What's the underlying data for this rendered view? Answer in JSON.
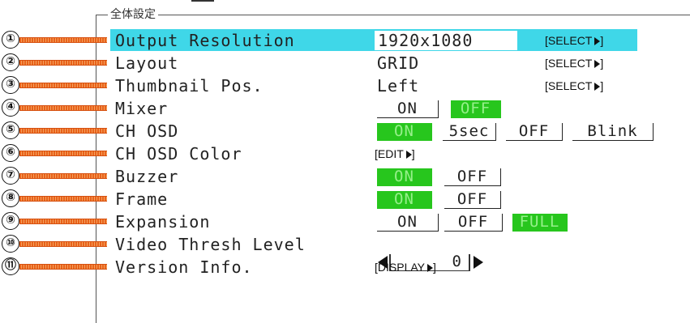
{
  "group_title": "全体設定",
  "rows": [
    {
      "num": "①",
      "label": "Output Resolution",
      "value": "1920x1080",
      "action": "[SELECT"
    },
    {
      "num": "②",
      "label": "Layout",
      "value": "GRID",
      "action": "[SELECT"
    },
    {
      "num": "③",
      "label": "Thumbnail Pos.",
      "value": "Left",
      "action": "[SELECT"
    },
    {
      "num": "④",
      "label": "Mixer",
      "options": [
        "ON",
        "OFF"
      ]
    },
    {
      "num": "⑤",
      "label": "CH OSD",
      "options": [
        "ON",
        "5sec",
        "OFF",
        "Blink"
      ]
    },
    {
      "num": "⑥",
      "label": "CH OSD Color",
      "action": "[EDIT"
    },
    {
      "num": "⑦",
      "label": "Buzzer",
      "options": [
        "ON",
        "OFF"
      ]
    },
    {
      "num": "⑧",
      "label": "Frame",
      "options": [
        "ON",
        "OFF"
      ]
    },
    {
      "num": "⑨",
      "label": "Expansion",
      "options": [
        "ON",
        "OFF",
        "FULL"
      ]
    },
    {
      "num": "⑩",
      "label": "Video Thresh Level",
      "slider_value": "0"
    },
    {
      "num": "⑪",
      "label": "Version Info.",
      "action": "[DISPLAY"
    }
  ],
  "colors": {
    "highlight": "#3fd7e8",
    "selected": "#27c61d",
    "callout_line": "#e8621a"
  },
  "icons": {
    "select_arrow": "triangle-right-icon",
    "slider_left": "triangle-left-icon",
    "slider_right": "triangle-right-icon"
  }
}
